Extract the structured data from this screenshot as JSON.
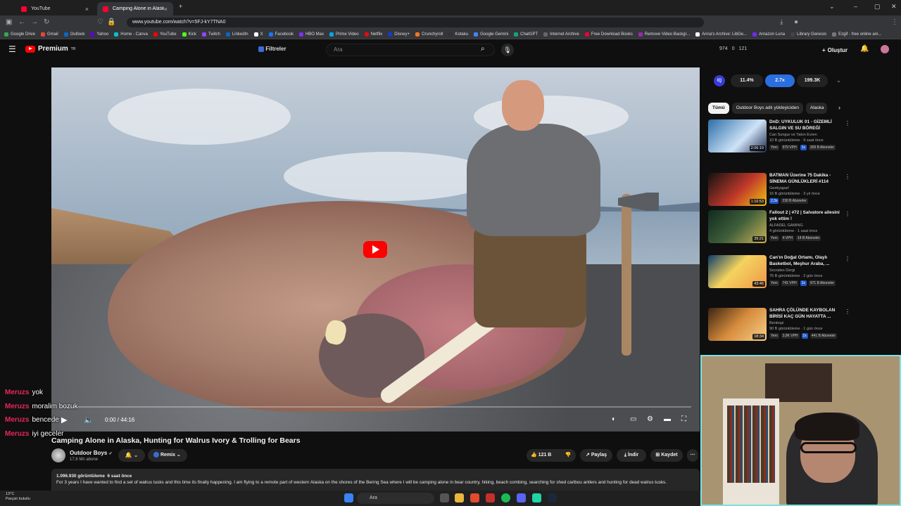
{
  "browser": {
    "tabs": [
      {
        "label": "YouTube",
        "active": false
      },
      {
        "label": "Camping Alone in Alaska, Hunt",
        "active": true
      }
    ],
    "new_tab": "+",
    "url": "www.youtube.com/watch?v=5FJ-kY7TNA0",
    "bookmarks": [
      "Google Drive",
      "Gmail",
      "Outlook",
      "Yahoo",
      "Home - Canva",
      "YouTube",
      "Kick",
      "Twitch",
      "LinkedIn",
      "X",
      "Facebook",
      "HBO Max",
      "Prime Video",
      "Netflix",
      "Disney+",
      "Crunchyroll",
      "Kotaku",
      "Google Gemini",
      "ChatGPT",
      "Internet Archive",
      "Free Download Books",
      "Remove Video Backgr...",
      "Anna's Archive: LibGe...",
      "Amazon Luna",
      "Library Genesis",
      "Ezgif - free online ani..."
    ]
  },
  "header": {
    "logo_text": "Premium",
    "logo_sup": "TR",
    "filters_label": "Filtreler",
    "search_placeholder": "Ara",
    "stats": [
      "974",
      "0",
      "121"
    ],
    "create_label": "Oluştur"
  },
  "player": {
    "time": "0:00 / 44:16",
    "progress": 0.0
  },
  "chat": [
    {
      "user": "Meruzs",
      "msg": "yok"
    },
    {
      "user": "Meruzs",
      "msg": "moralim bozuk"
    },
    {
      "user": "Meruzs",
      "msg": "bencede"
    },
    {
      "user": "Meruzs",
      "msg": "iyi geceler"
    }
  ],
  "video": {
    "title": "Camping Alone in Alaska, Hunting for Walrus Ivory & Trolling for Bears",
    "channel": "Outdoor Boys",
    "subs": "17,6 Mn abone",
    "remix_label": "Remix",
    "likes": "121 B",
    "share_label": "Paylaş",
    "download_label": "İndir",
    "save_label": "Kaydet",
    "views": "1.096.930 görüntüleme",
    "age": "6 saat önce",
    "description": "For 3 years I have wanted to find a set of walrus tusks and this time its finally happening. I am flying to a remote part of western Alaska on the shores of the Bering Sea where I will be camping alone in bear country, hiking, beach combing, searching for shed caribou antlers and hunting for dead walrus tusks."
  },
  "sidebar": {
    "iq_label": "IQ",
    "stat_pills": [
      "11.4%",
      "2.7x",
      "199.3K"
    ],
    "chips": [
      "Tümü",
      "Outdoor Boys adlı yükleyiciden",
      "Alaska"
    ],
    "recommendations": [
      {
        "title": "DnD: UYKULUK 01 - GİZEMLİ SALGIN VE SU BÖREĞİ",
        "channel": "Can Sungur ve Yakın Evren",
        "meta": "10 B görüntüleme · 9 saat önce",
        "duration": "2:06:19",
        "tags": [
          "Yeni"
        ],
        "stats": [
          "979 VPH",
          "1x",
          "309 B Aboneler"
        ]
      },
      {
        "title": "BATMAN Üzerine 75 Dakika - SİNEMA GÜNLÜKLERİ #114",
        "channel": "Geekyapar!",
        "meta": "16 B görüntüleme · 3 yıl önce",
        "duration": "1:16:53",
        "tags": [],
        "stats": [
          "2,3x",
          "230 B Aboneler"
        ]
      },
      {
        "title": "Fallout 2 | #72 | Salvatore ailesini yok ettim !",
        "channel": "ALFADEL GAMING",
        "meta": "4 görüntüleme · 1 saat önce",
        "duration": "39:21",
        "tags": [
          "Yeni"
        ],
        "stats": [
          "4 VPH",
          "14 B Aboneler"
        ]
      },
      {
        "title": "Can'ın Doğal Ortamı, Olaylı Basketbol, Meşhur Araba, ...",
        "channel": "Socrates Dergi",
        "meta": "76 B görüntüleme · 2 gün önce",
        "duration": "43:46",
        "tags": [
          "Yeni"
        ],
        "stats": [
          "741 VPH",
          "1x",
          "971 B Aboneler"
        ]
      },
      {
        "title": "SAHRA ÇÖLÜNDE KAYBOLAN BİRİSİ KAÇ GÜN HAYATTA ...",
        "channel": "Bentropi",
        "meta": "90 B görüntüleme · 1 gün önce",
        "duration": "18:34",
        "tags": [
          "Yeni"
        ],
        "stats": [
          "3,9K VPH",
          "1x",
          "441 B Aboneler"
        ]
      }
    ]
  },
  "taskbar": {
    "weather_temp": "13°C",
    "weather_desc": "Parçalı bulutlu",
    "search_placeholder": "Ara"
  },
  "colors": {
    "accent": "#ff0000",
    "chat_user": "#e8275b",
    "cam_border": "#7ae3e0"
  }
}
